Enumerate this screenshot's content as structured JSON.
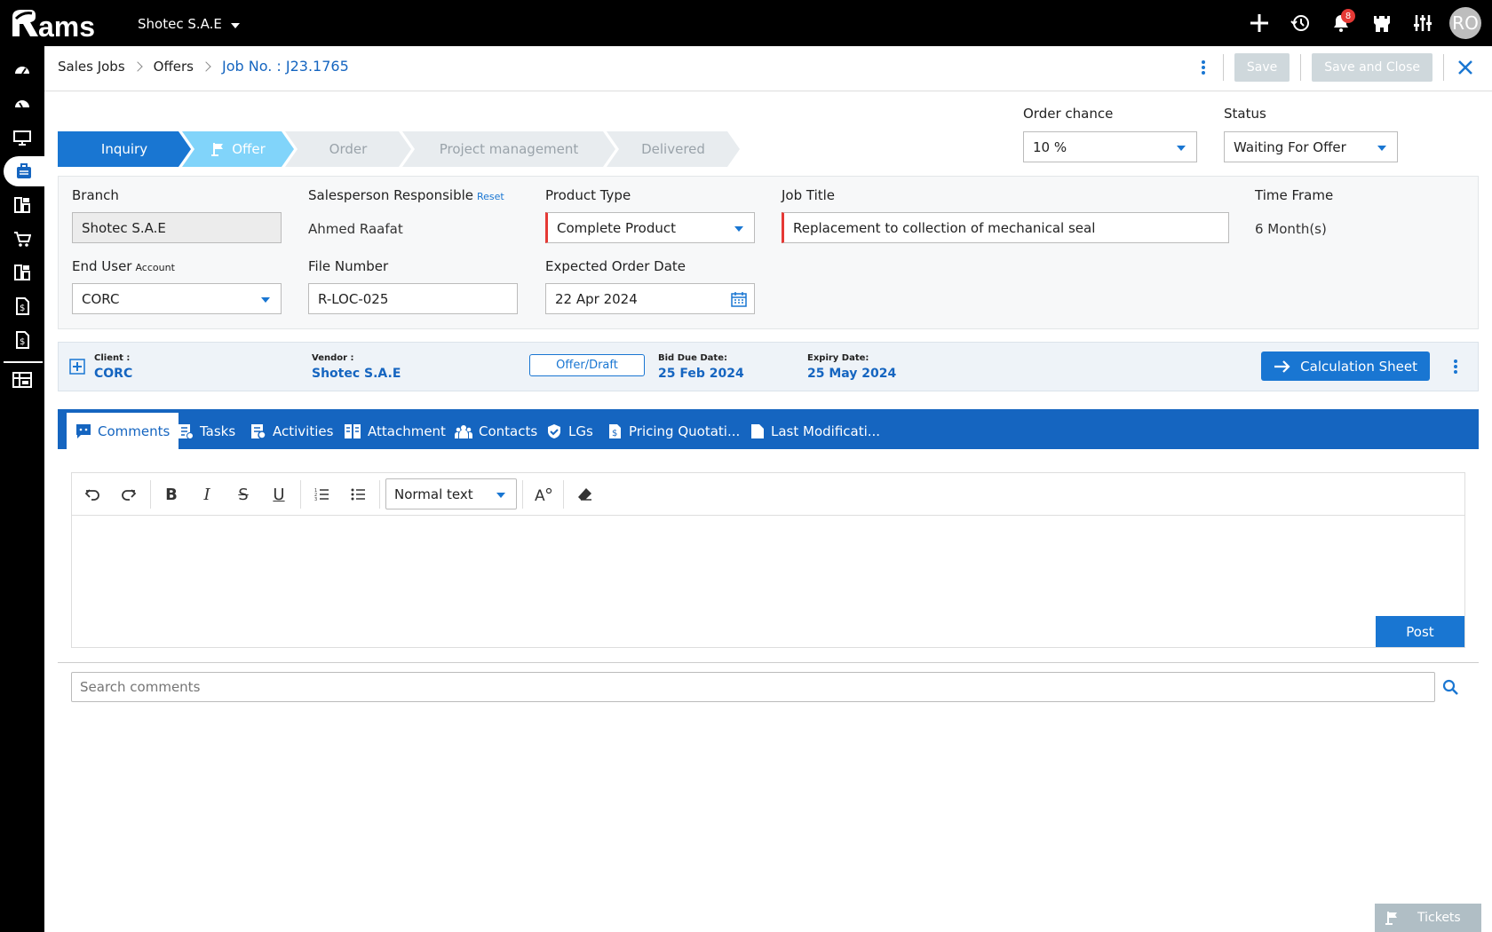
{
  "app": {
    "logo_text": "Rams",
    "company": "Shotec S.A.E",
    "notifications_count": "8",
    "user_initials": "RO"
  },
  "breadcrumb": {
    "items": [
      "Sales Jobs",
      "Offers"
    ],
    "current": "Job No. : J23.1765"
  },
  "header_actions": {
    "save": "Save",
    "save_close": "Save and Close"
  },
  "stepper": {
    "steps": [
      "Inquiry",
      "Offer",
      "Order",
      "Project management",
      "Delivered"
    ],
    "current_index": 1
  },
  "order_chance": {
    "label": "Order chance",
    "value": "10 %"
  },
  "status": {
    "label": "Status",
    "value": "Waiting For Offer"
  },
  "form": {
    "branch": {
      "label": "Branch",
      "value": "Shotec S.A.E"
    },
    "salesperson": {
      "label": "Salesperson Responsible",
      "reset": "Reset",
      "value": "Ahmed Raafat"
    },
    "product_type": {
      "label": "Product Type",
      "value": "Complete Product"
    },
    "job_title": {
      "label": "Job Title",
      "value": "Replacement to collection of mechanical seal"
    },
    "time_frame": {
      "label": "Time Frame",
      "value": "6 Month(s)"
    },
    "end_user": {
      "label": "End User",
      "hint": "Account",
      "value": "CORC"
    },
    "file_number": {
      "label": "File Number",
      "value": "R-LOC-025"
    },
    "expected_order_date": {
      "label": "Expected Order Date",
      "value": "22 Apr 2024"
    }
  },
  "info": {
    "client_label": "Client :",
    "client": "CORC",
    "vendor_label": "Vendor :",
    "vendor": "Shotec S.A.E",
    "chip": "Offer/Draft",
    "bid_label": "Bid Due Date:",
    "bid": "25 Feb 2024",
    "expiry_label": "Expiry Date:",
    "expiry": "25 May 2024",
    "calc_button": "Calculation Sheet"
  },
  "tabs": [
    "Comments",
    "Tasks",
    "Activities",
    "Attachment",
    "Contacts",
    "LGs",
    "Pricing Quotati...",
    "Last Modificati..."
  ],
  "editor": {
    "format": "Normal text",
    "post": "Post"
  },
  "search": {
    "placeholder": "Search comments"
  },
  "footer": {
    "tickets": "Tickets"
  }
}
